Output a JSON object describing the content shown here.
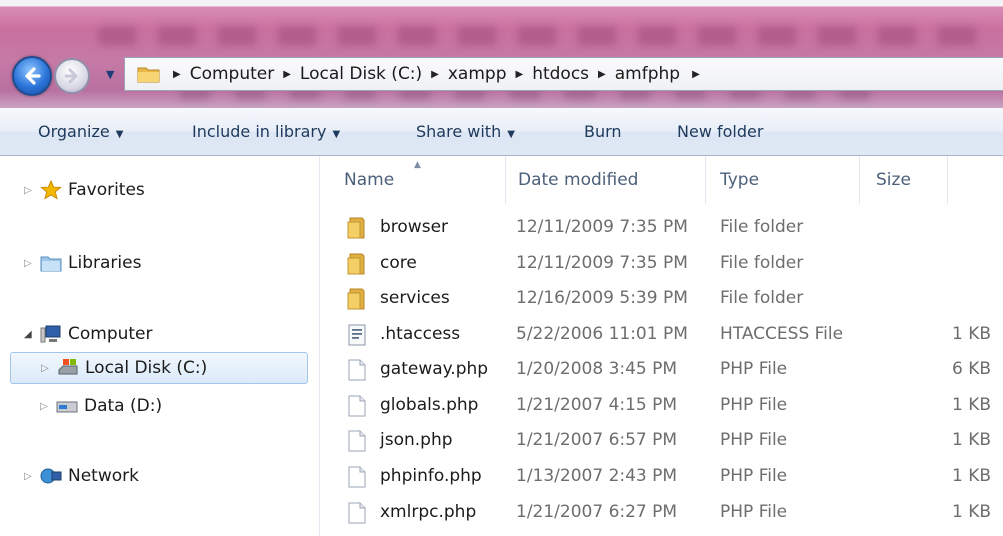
{
  "address": {
    "breadcrumbs": [
      "Computer",
      "Local Disk (C:)",
      "xampp",
      "htdocs",
      "amfphp"
    ]
  },
  "toolbar": {
    "organize": "Organize",
    "include_in_library": "Include in library",
    "share_with": "Share with",
    "burn": "Burn",
    "new_folder": "New folder"
  },
  "navpane": {
    "favorites": "Favorites",
    "libraries": "Libraries",
    "computer": "Computer",
    "local_disk": "Local Disk (C:)",
    "data_disk": "Data (D:)",
    "network": "Network"
  },
  "columns": {
    "name": "Name",
    "date_modified": "Date modified",
    "type": "Type",
    "size": "Size"
  },
  "files": [
    {
      "name": "browser",
      "date": "12/11/2009 7:35 PM",
      "type": "File folder",
      "size": "",
      "icon": "folder-icon"
    },
    {
      "name": "core",
      "date": "12/11/2009 7:35 PM",
      "type": "File folder",
      "size": "",
      "icon": "folder-icon"
    },
    {
      "name": "services",
      "date": "12/16/2009 5:39 PM",
      "type": "File folder",
      "size": "",
      "icon": "folder-icon"
    },
    {
      "name": ".htaccess",
      "date": "5/22/2006 11:01 PM",
      "type": "HTACCESS File",
      "size": "1 KB",
      "icon": "config-file-icon"
    },
    {
      "name": "gateway.php",
      "date": "1/20/2008 3:45 PM",
      "type": "PHP File",
      "size": "6 KB",
      "icon": "document-icon"
    },
    {
      "name": "globals.php",
      "date": "1/21/2007 4:15 PM",
      "type": "PHP File",
      "size": "1 KB",
      "icon": "document-icon"
    },
    {
      "name": "json.php",
      "date": "1/21/2007 6:57 PM",
      "type": "PHP File",
      "size": "1 KB",
      "icon": "document-icon"
    },
    {
      "name": "phpinfo.php",
      "date": "1/13/2007 2:43 PM",
      "type": "PHP File",
      "size": "1 KB",
      "icon": "document-icon"
    },
    {
      "name": "xmlrpc.php",
      "date": "1/21/2007 6:27 PM",
      "type": "PHP File",
      "size": "1 KB",
      "icon": "document-icon"
    }
  ],
  "colors": {
    "aero": "#c9709f",
    "selection": "#dbeaf9",
    "toolbar_text": "#1e395b"
  }
}
